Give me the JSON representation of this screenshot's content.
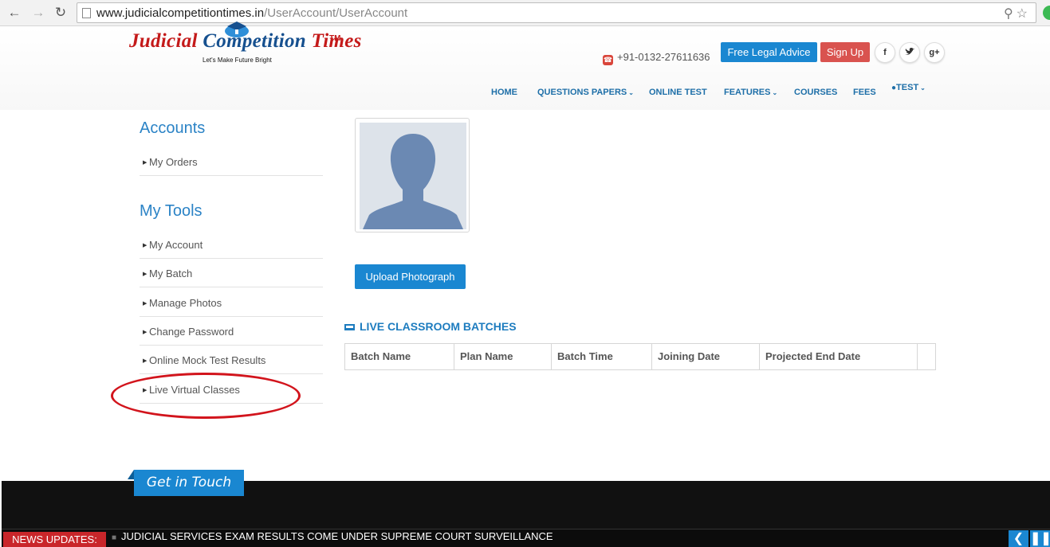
{
  "browser": {
    "url_domain": "www.judicialcompetitiontimes.in",
    "url_path": "/UserAccount/UserAccount"
  },
  "header": {
    "logo": {
      "word1": "Judicial",
      "word2": "Competition",
      "word3": "Times",
      "tm": "TM",
      "tagline": "Let's Make Future Bright"
    },
    "phone": "+91-0132-27611636",
    "advice_button": "Free Legal Advice",
    "signup_button": "Sign Up",
    "social": [
      "f",
      "t",
      "g+"
    ],
    "nav": [
      {
        "label": "HOME",
        "dropdown": false
      },
      {
        "label": "QUESTIONS PAPERS",
        "dropdown": true
      },
      {
        "label": "ONLINE TEST",
        "dropdown": false
      },
      {
        "label": "FEATURES",
        "dropdown": true
      },
      {
        "label": "COURSES",
        "dropdown": false
      },
      {
        "label": "FEES",
        "dropdown": false
      },
      {
        "label": "TEST",
        "dropdown": true
      }
    ]
  },
  "sidebar": {
    "accounts_title": "Accounts",
    "accounts_items": [
      "My Orders"
    ],
    "tools_title": "My Tools",
    "tools_items": [
      "My Account",
      "My Batch",
      "Manage Photos",
      "Change Password",
      "Online Mock Test Results",
      "Live Virtual Classes"
    ]
  },
  "profile": {
    "upload_button": "Upload Photograph"
  },
  "batches": {
    "title": "LIVE CLASSROOM BATCHES",
    "columns": [
      "Batch Name",
      "Plan Name",
      "Batch Time",
      "Joining Date",
      "Projected End Date"
    ]
  },
  "footer": {
    "get_in_touch": "Get in Touch",
    "news_label": "NEWS UPDATES:",
    "news_item": "JUDICIAL SERVICES EXAM RESULTS COME UNDER SUPREME COURT SURVEILLANCE"
  },
  "colors": {
    "accent": "#1a87d1",
    "brand_red": "#c41a1a",
    "annotation": "#d2141c"
  }
}
